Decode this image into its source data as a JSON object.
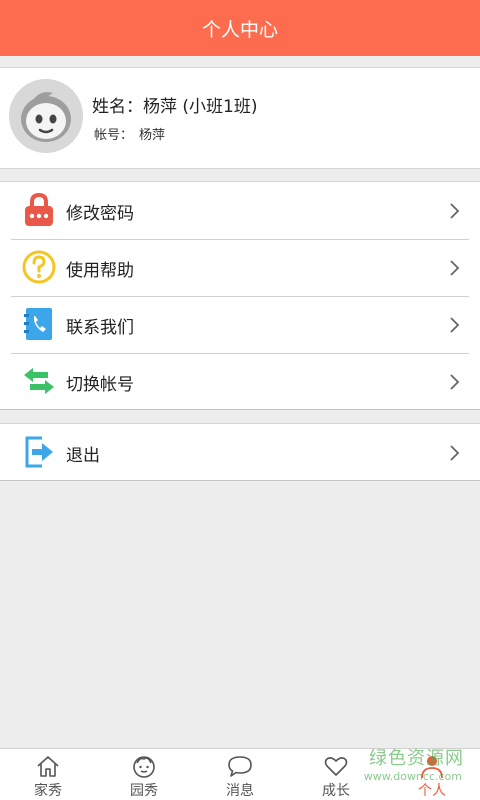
{
  "header": {
    "title": "个人中心"
  },
  "profile": {
    "name_label": "姓名：",
    "name": "杨萍 (小班1班)",
    "account_label": "帐号：",
    "account": "杨萍"
  },
  "menu": [
    {
      "label": "修改密码",
      "icon": "lock-icon",
      "color": "#e9594a"
    },
    {
      "label": "使用帮助",
      "icon": "help-icon",
      "color": "#f3c623"
    },
    {
      "label": "联系我们",
      "icon": "phone-book-icon",
      "color": "#3ba6ea"
    },
    {
      "label": "切换帐号",
      "icon": "switch-arrows-icon",
      "color": "#3bc266"
    }
  ],
  "exit": {
    "label": "退出",
    "icon": "logout-icon",
    "color": "#3ba6ea"
  },
  "tabs": [
    {
      "label": "家秀",
      "icon": "home-icon"
    },
    {
      "label": "园秀",
      "icon": "kid-face-icon"
    },
    {
      "label": "消息",
      "icon": "chat-bubble-icon"
    },
    {
      "label": "成长",
      "icon": "heart-icon"
    },
    {
      "label": "个人",
      "icon": "person-icon",
      "active": true
    }
  ],
  "watermark": {
    "text": "绿色资源网",
    "url": "www.downcc.com"
  },
  "colors": {
    "header": "#fd6c4e",
    "active_tab": "#ec5a3a",
    "background": "#ededed"
  }
}
